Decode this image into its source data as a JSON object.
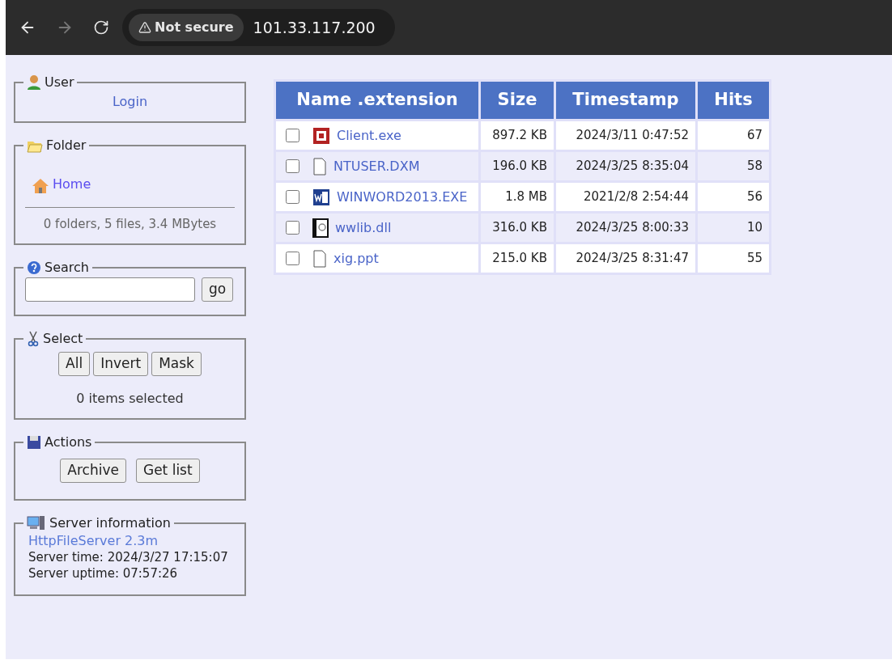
{
  "browser": {
    "security_label": "Not secure",
    "address": "101.33.117.200"
  },
  "user_panel": {
    "title": "User",
    "login_link": "Login"
  },
  "folder_panel": {
    "title": "Folder",
    "home_link": "Home",
    "summary": "0 folders, 5 files, 3.4 MBytes"
  },
  "search_panel": {
    "title": "Search",
    "go_button": "go"
  },
  "select_panel": {
    "title": "Select",
    "buttons": [
      "All",
      "Invert",
      "Mask"
    ],
    "status": "0 items selected"
  },
  "actions_panel": {
    "title": "Actions",
    "buttons": [
      "Archive",
      "Get list"
    ]
  },
  "server_panel": {
    "title": "Server information",
    "product_link": "HttpFileServer 2.3m",
    "lines": [
      "Server time: 2024/3/27 17:15:07",
      "Server uptime: 07:57:26"
    ]
  },
  "table": {
    "columns": [
      "Name .extension",
      "Size",
      "Timestamp",
      "Hits"
    ],
    "rows": [
      {
        "kind": "app",
        "name": "Client.exe",
        "size": "897.2 KB",
        "timestamp": "2024/3/11 0:47:52",
        "hits": "67",
        "checked": false
      },
      {
        "kind": "blank",
        "name": "NTUSER.DXM",
        "size": "196.0 KB",
        "timestamp": "2024/3/25 8:35:04",
        "hits": "58",
        "checked": false
      },
      {
        "kind": "word",
        "name": "WINWORD2013.EXE",
        "size": "1.8 MB",
        "timestamp": "2021/2/8 2:54:44",
        "hits": "56",
        "checked": false
      },
      {
        "kind": "library",
        "name": "wwlib.dll",
        "size": "316.0 KB",
        "timestamp": "2024/3/25 8:00:33",
        "hits": "10",
        "checked": false
      },
      {
        "kind": "blank",
        "name": "xig.ppt",
        "size": "215.0 KB",
        "timestamp": "2024/3/25 8:31:47",
        "hits": "55",
        "checked": false
      }
    ]
  }
}
